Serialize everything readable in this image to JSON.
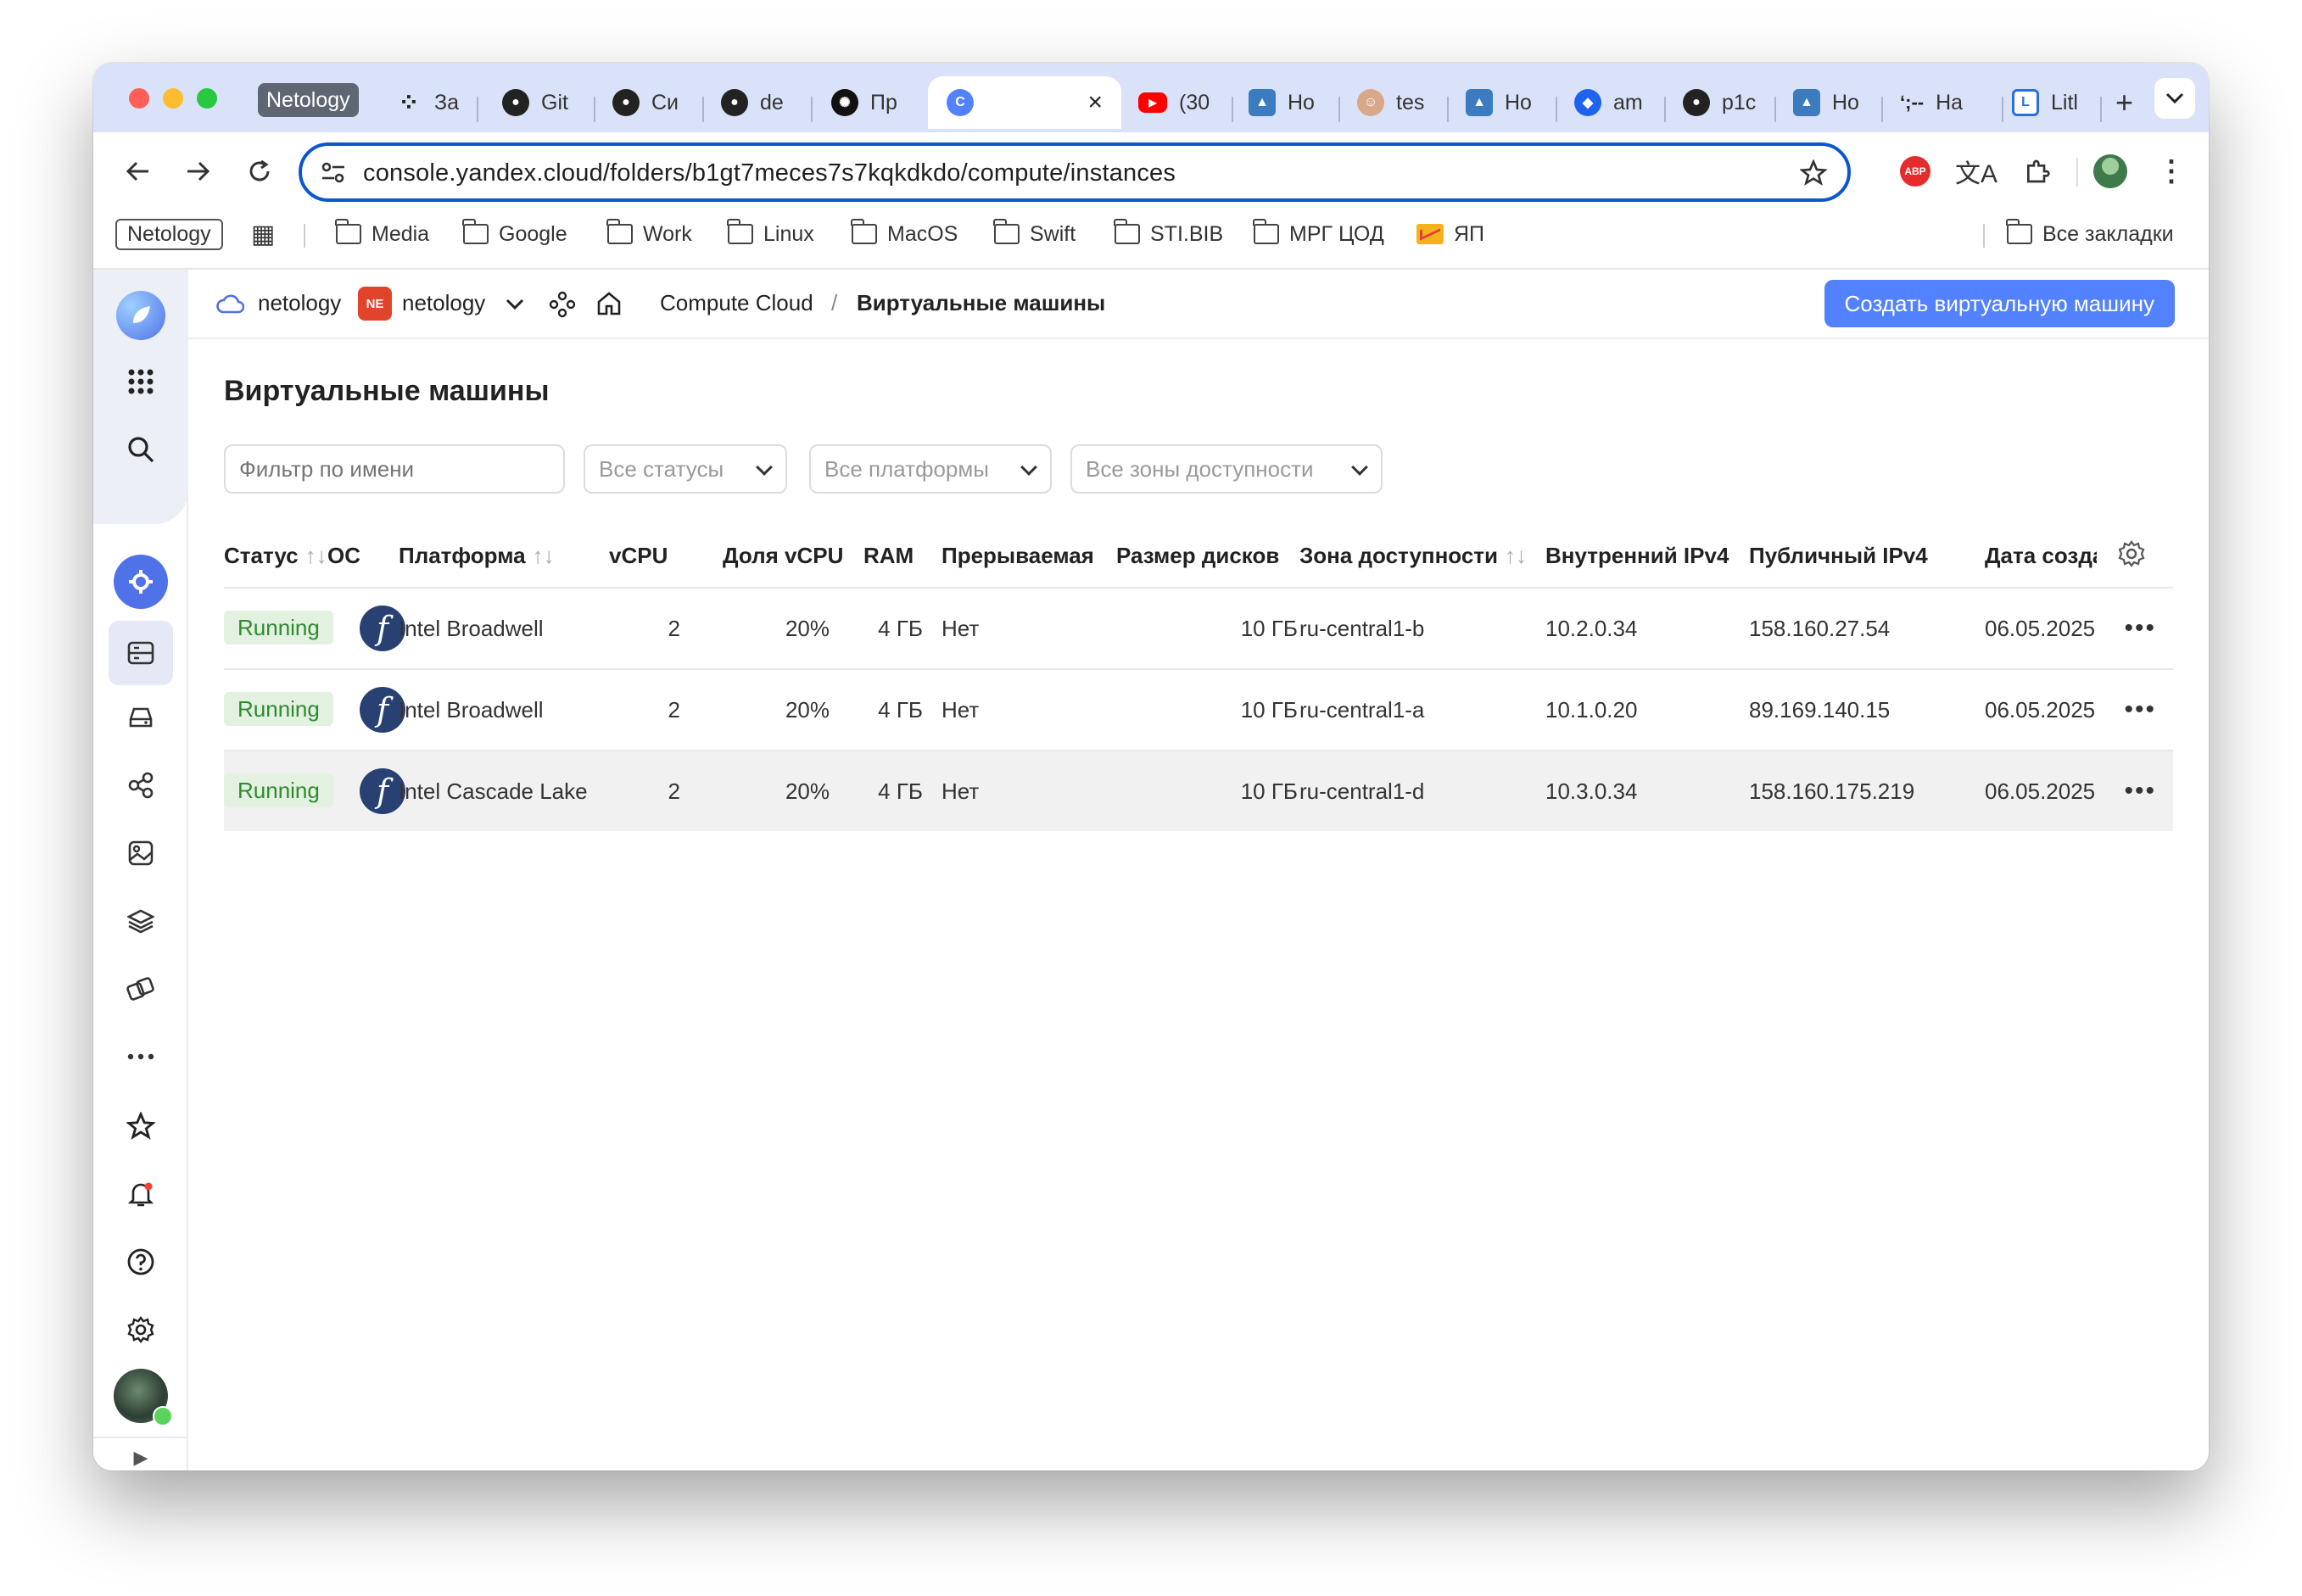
{
  "browser": {
    "tabs": [
      {
        "label": "Netology",
        "icon": "netology-group-label"
      },
      {
        "label": "За",
        "icon": "dots-app-icon"
      },
      {
        "label": "Git",
        "icon": "github-icon"
      },
      {
        "label": "Си",
        "icon": "github-icon"
      },
      {
        "label": "de",
        "icon": "github-icon"
      },
      {
        "label": "Пр",
        "icon": "openai-icon"
      },
      {
        "label": "",
        "icon": "yandex-cloud-icon",
        "active": true
      },
      {
        "label": "(30",
        "icon": "youtube-icon"
      },
      {
        "label": "Ho",
        "icon": "image-app-icon"
      },
      {
        "label": "tes",
        "icon": "avatar-icon"
      },
      {
        "label": "Ho",
        "icon": "image-app-icon"
      },
      {
        "label": "am",
        "icon": "docker-icon"
      },
      {
        "label": "p1c",
        "icon": "github-icon"
      },
      {
        "label": "Ho",
        "icon": "image-app-icon"
      },
      {
        "label": "Ha",
        "icon": "habr-icon"
      },
      {
        "label": "Litl",
        "icon": "litl-icon"
      }
    ],
    "tab_favicon_text": {
      "habr": "ʻ;--",
      "abp": "ABP",
      "ne": "NE"
    },
    "new_tab": "+",
    "url": "console.yandex.cloud/folders/b1gt7meces7s7kqkdkdo/compute/instances",
    "bookmarks": [
      {
        "label": "Netology",
        "type": "boxed"
      },
      {
        "label": "",
        "type": "apps"
      },
      {
        "label": "Media",
        "type": "folder"
      },
      {
        "label": "Google",
        "type": "folder"
      },
      {
        "label": "Work",
        "type": "folder"
      },
      {
        "label": "Linux",
        "type": "folder"
      },
      {
        "label": "MacOS",
        "type": "folder"
      },
      {
        "label": "Swift",
        "type": "folder"
      },
      {
        "label": "STI.BIB",
        "type": "folder"
      },
      {
        "label": "МРГ ЦОД",
        "type": "folder"
      },
      {
        "label": "ЯП",
        "type": "mail"
      }
    ],
    "all_bookmarks": "Все закладки"
  },
  "header": {
    "cloud": "netology",
    "org_badge": "NE",
    "folder": "netology",
    "service": "Compute Cloud",
    "separator": "/",
    "page": "Виртуальные машины",
    "create_button": "Создать виртуальную машину"
  },
  "page_title": "Виртуальные машины",
  "filters": {
    "name_placeholder": "Фильтр по имени",
    "status": "Все статусы",
    "platform": "Все платформы",
    "zone": "Все зоны доступности"
  },
  "table": {
    "columns": [
      "Статус",
      "ОС",
      "Платформа",
      "vCPU",
      "Доля vCPU",
      "RAM",
      "Прерываемая",
      "Размер дисков",
      "Зона доступности",
      "Внутренний IPv4",
      "Публичный IPv4",
      "Дата созда"
    ],
    "sort_glyph": "↑↓",
    "rows": [
      {
        "status": "Running",
        "os": "fedora",
        "platform": "Intel Broadwell",
        "vcpu": "2",
        "share": "20%",
        "ram": "4 ГБ",
        "preemptible": "Нет",
        "disk": "10 ГБ",
        "zone": "ru-central1-b",
        "internal_ip": "10.2.0.34",
        "public_ip": "158.160.27.54",
        "date": "06.05.2025"
      },
      {
        "status": "Running",
        "os": "fedora",
        "platform": "Intel Broadwell",
        "vcpu": "2",
        "share": "20%",
        "ram": "4 ГБ",
        "preemptible": "Нет",
        "disk": "10 ГБ",
        "zone": "ru-central1-a",
        "internal_ip": "10.1.0.20",
        "public_ip": "89.169.140.15",
        "date": "06.05.2025"
      },
      {
        "status": "Running",
        "os": "fedora",
        "platform": "Intel Cascade Lake",
        "vcpu": "2",
        "share": "20%",
        "ram": "4 ГБ",
        "preemptible": "Нет",
        "disk": "10 ГБ",
        "zone": "ru-central1-d",
        "internal_ip": "10.3.0.34",
        "public_ip": "158.160.175.219",
        "date": "06.05.2025"
      }
    ]
  },
  "colors": {
    "accent": "#5282ff",
    "running_bg": "#e2f1e0",
    "running_text": "#2f8a2f",
    "tabbar": "#dae2f9",
    "fedora": "#294172"
  }
}
